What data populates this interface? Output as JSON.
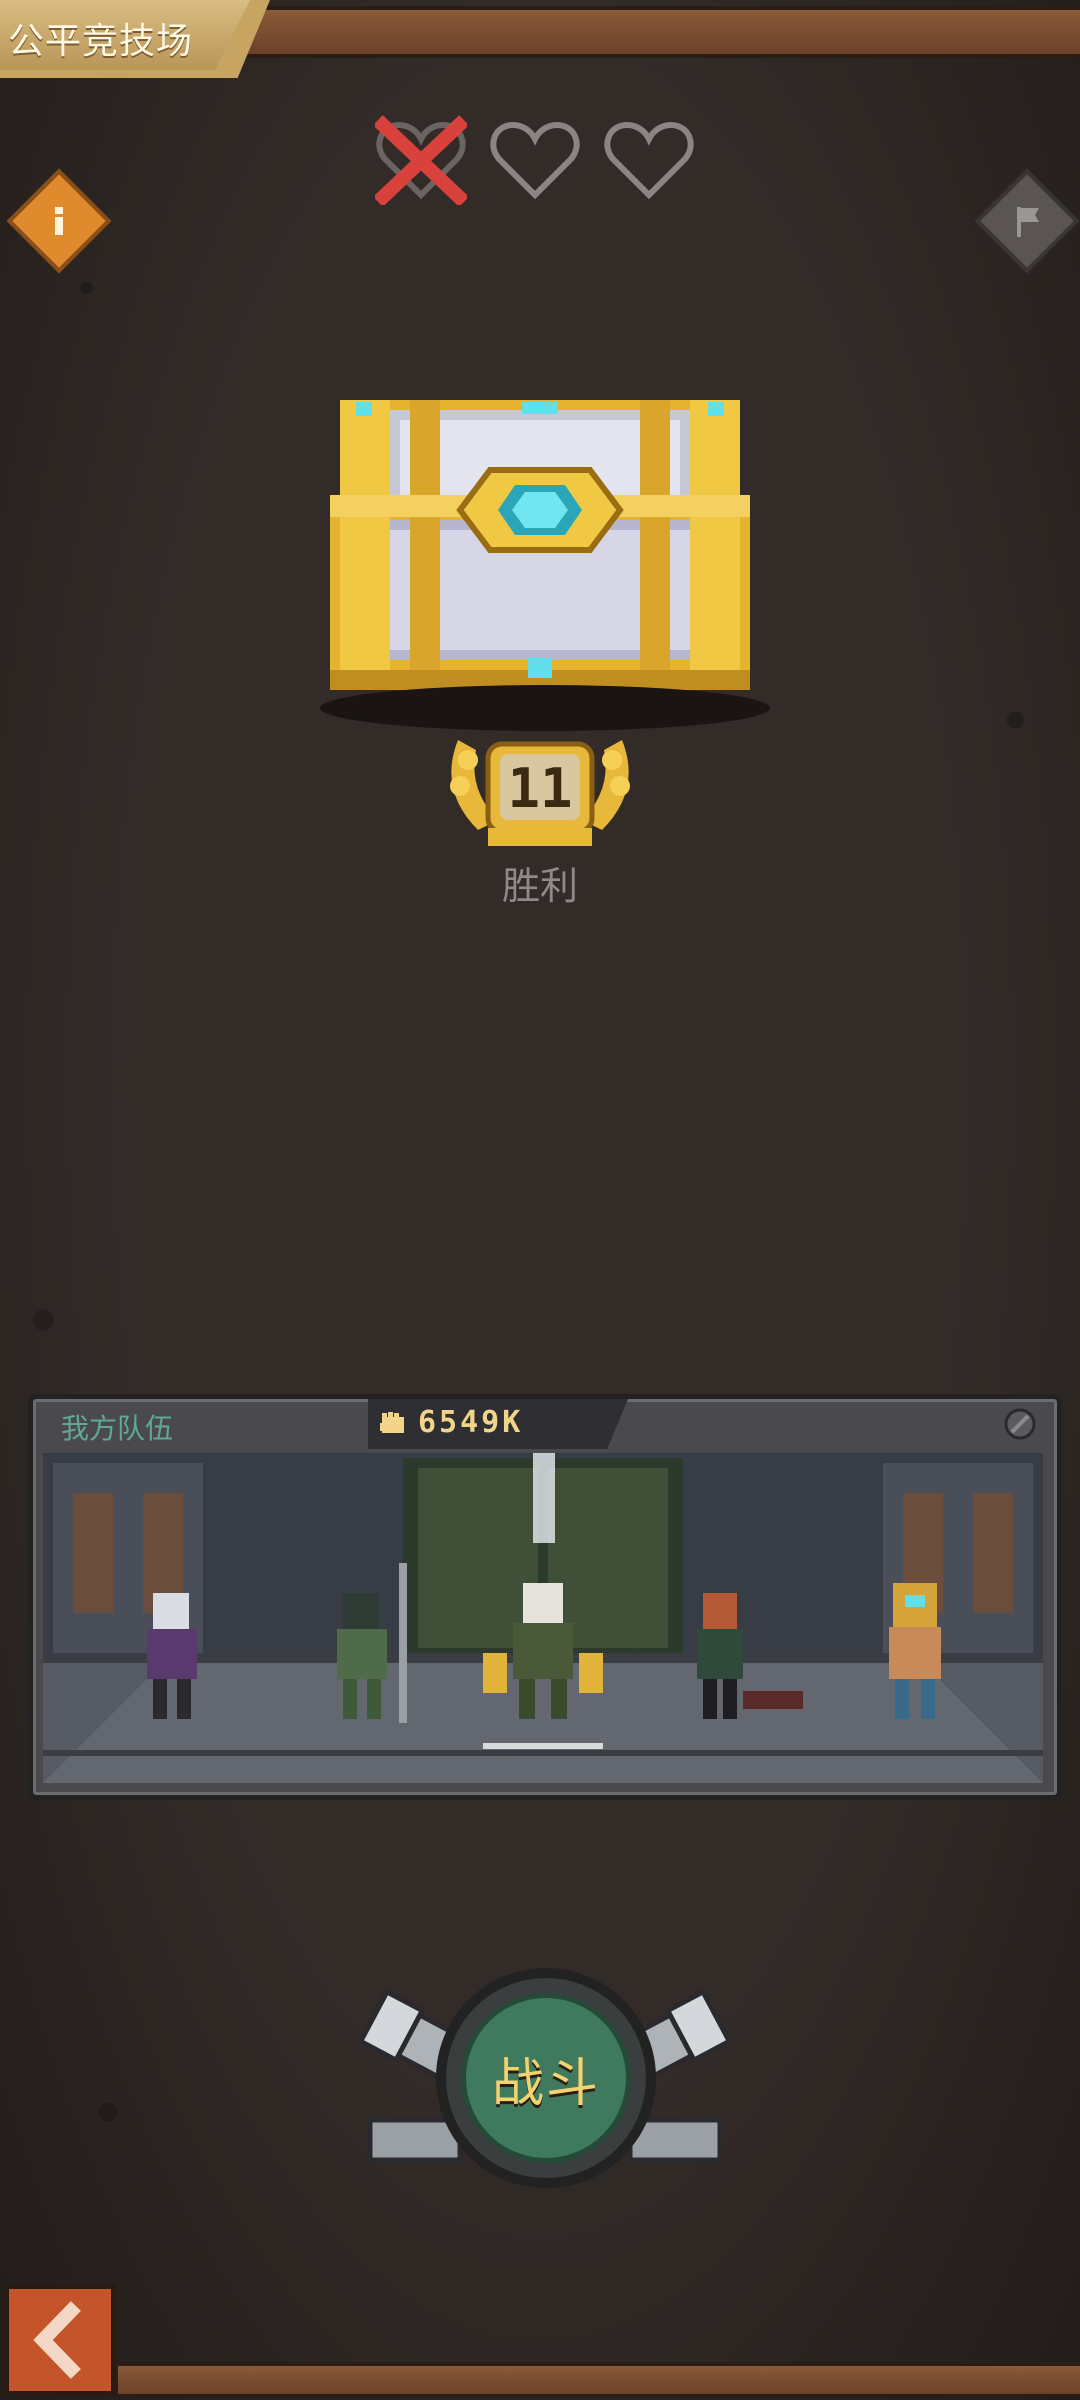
{
  "header": {
    "title": "公平竞技场"
  },
  "lives": [
    {
      "state": "lost",
      "icon": "heart-x-icon"
    },
    {
      "state": "empty",
      "icon": "heart-outline-icon"
    },
    {
      "state": "empty",
      "icon": "heart-outline-icon"
    }
  ],
  "buttons": {
    "info_icon": "info-icon",
    "flag_icon": "flag-icon",
    "back_icon": "chevron-left-icon"
  },
  "reward": {
    "chest": "golden-treasure-chest",
    "wins_count": "11",
    "wins_label": "胜利"
  },
  "team": {
    "label": "我方队伍",
    "power": "6549K",
    "members": [
      "hero-1",
      "hero-2",
      "hero-3",
      "hero-4",
      "hero-5"
    ]
  },
  "battle": {
    "label": "战斗"
  },
  "colors": {
    "background": "#322b28",
    "accent_gold": "#e8b83a",
    "battle_green": "#3f7a5e",
    "lost_red": "#d9423c"
  }
}
